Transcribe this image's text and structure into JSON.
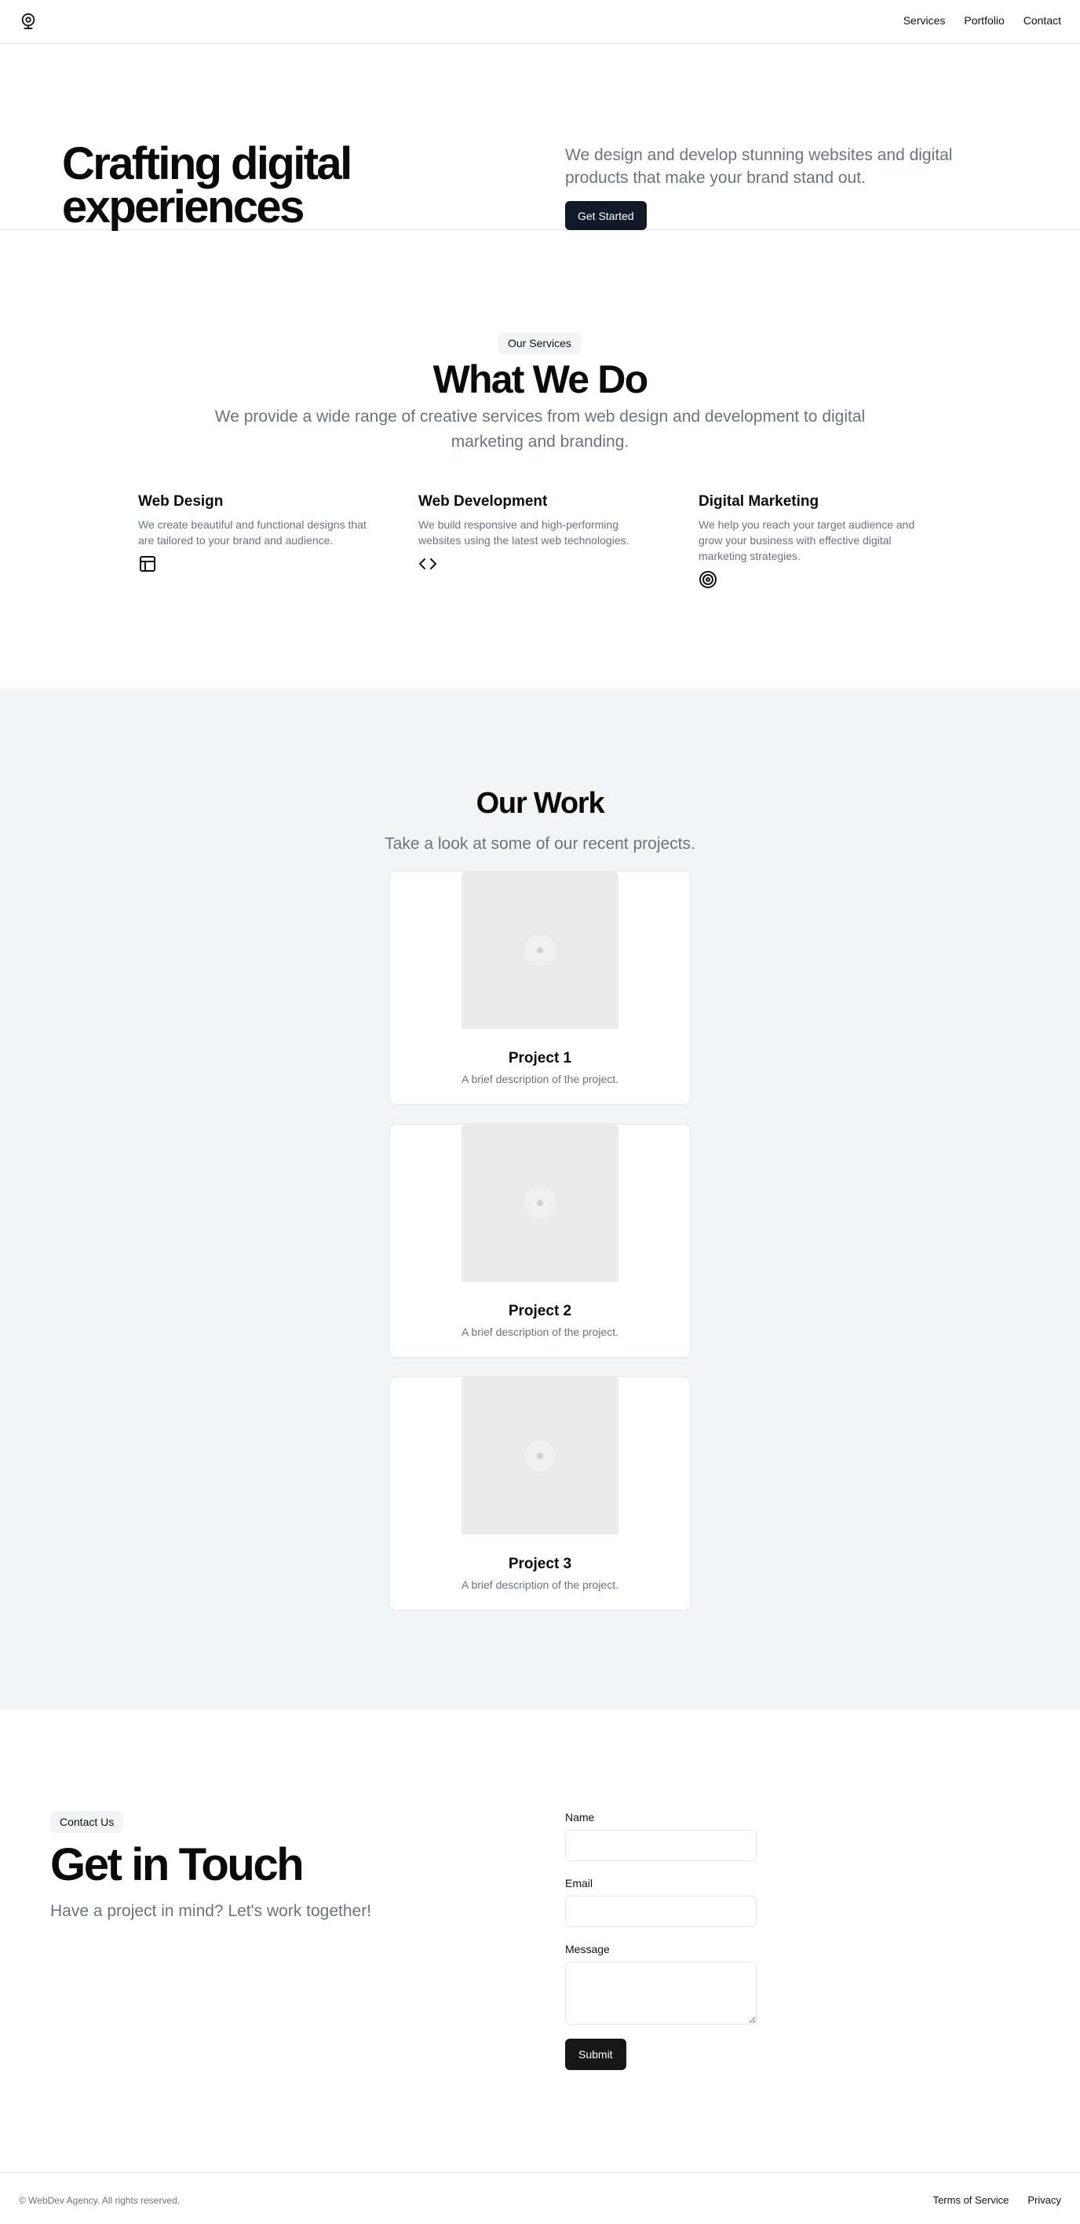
{
  "header": {
    "logo_icon": "webcam-icon",
    "nav": [
      {
        "label": "Services"
      },
      {
        "label": "Portfolio"
      },
      {
        "label": "Contact"
      }
    ]
  },
  "hero": {
    "title": "Crafting digital experiences",
    "subtitle": "We design and develop stunning websites and digital products that make your brand stand out.",
    "cta_label": "Get Started"
  },
  "services": {
    "badge": "Our Services",
    "title": "What We Do",
    "subtitle": "We provide a wide range of creative services from web design and development to digital marketing and branding.",
    "items": [
      {
        "title": "Web Design",
        "description": "We create beautiful and functional designs that are tailored to your brand and audience.",
        "icon": "layout-icon"
      },
      {
        "title": "Web Development",
        "description": "We build responsive and high-performing websites using the latest web technologies.",
        "icon": "code-icon"
      },
      {
        "title": "Digital Marketing",
        "description": "We help you reach your target audience and grow your business with effective digital marketing strategies.",
        "icon": "target-icon"
      }
    ]
  },
  "work": {
    "title": "Our Work",
    "subtitle": "Take a look at some of our recent projects.",
    "projects": [
      {
        "title": "Project 1",
        "description": "A brief description of the project."
      },
      {
        "title": "Project 2",
        "description": "A brief description of the project."
      },
      {
        "title": "Project 3",
        "description": "A brief description of the project."
      }
    ]
  },
  "contact": {
    "badge": "Contact Us",
    "title": "Get in Touch",
    "subtitle": "Have a project in mind? Let's work together!",
    "form": {
      "name_label": "Name",
      "name_value": "",
      "email_label": "Email",
      "email_value": "",
      "message_label": "Message",
      "message_value": "",
      "submit_label": "Submit"
    }
  },
  "footer": {
    "copyright": "© WebDev Agency. All rights reserved.",
    "links": [
      {
        "label": "Terms of Service"
      },
      {
        "label": "Privacy"
      }
    ]
  },
  "colors": {
    "primary_button": "#111827",
    "submit_button": "#171717",
    "muted_text": "#6b7280",
    "section_alt_bg": "#f3f4f6",
    "border": "#e5e7eb"
  }
}
